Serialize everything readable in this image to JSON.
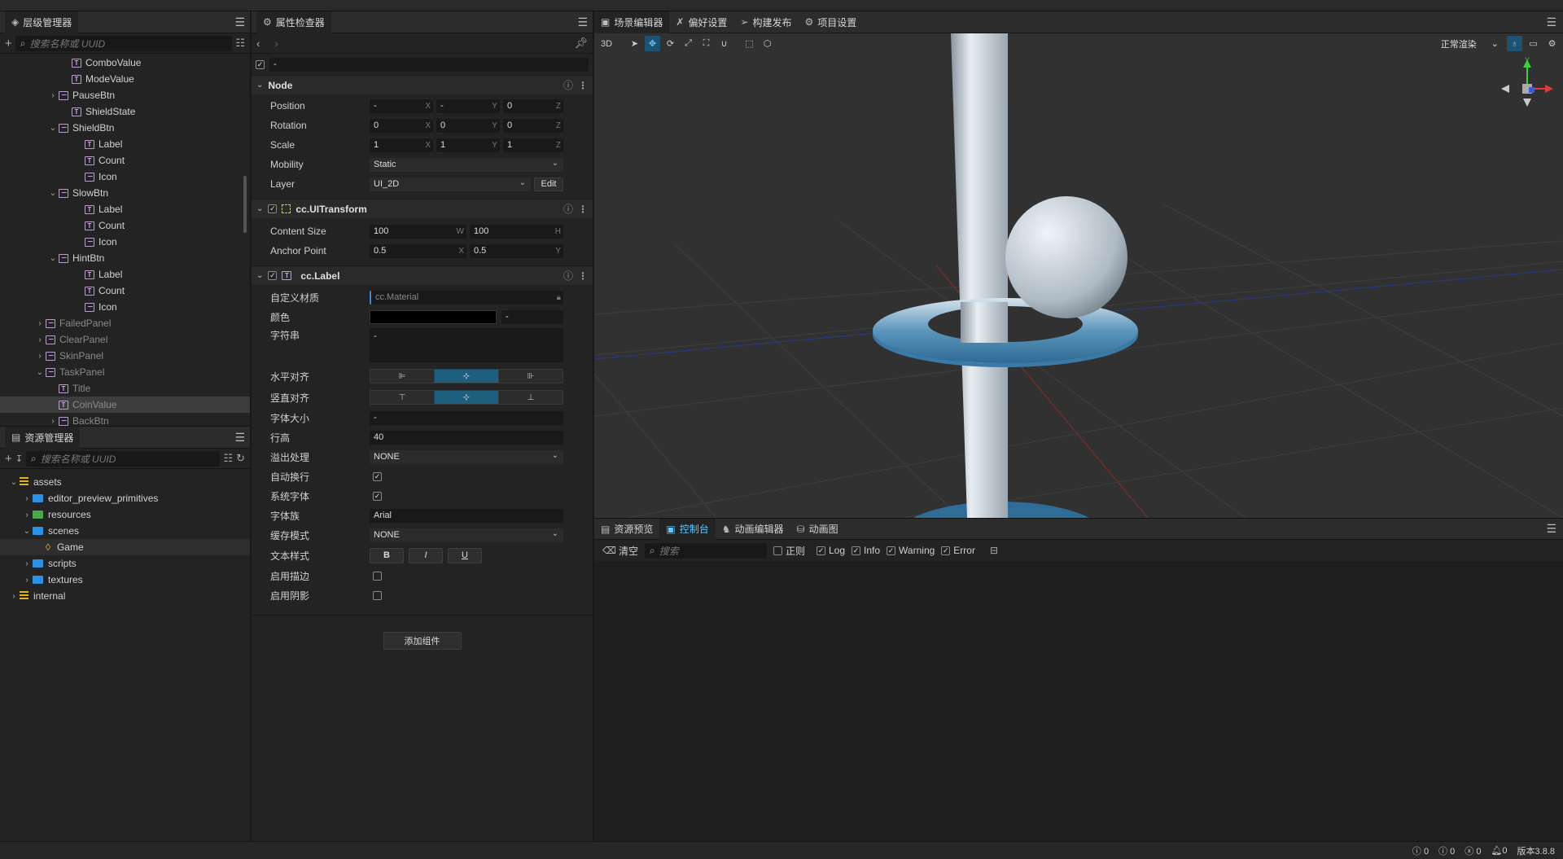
{
  "hierarchy": {
    "title": "层级管理器",
    "search_placeholder": "搜索名称或 UUID",
    "items": [
      {
        "label": "ComboValue",
        "icon": "text-icon",
        "indent": 5
      },
      {
        "label": "ModeValue",
        "icon": "text-icon",
        "indent": 5
      },
      {
        "label": "PauseBtn",
        "icon": "sprite-icon",
        "indent": 4,
        "arrow": "›"
      },
      {
        "label": "ShieldState",
        "icon": "text-icon",
        "indent": 5
      },
      {
        "label": "ShieldBtn",
        "icon": "sprite-icon",
        "indent": 4,
        "arrow": "⌄"
      },
      {
        "label": "Label",
        "icon": "text-icon",
        "indent": 6
      },
      {
        "label": "Count",
        "icon": "text-icon",
        "indent": 6
      },
      {
        "label": "Icon",
        "icon": "sprite-icon",
        "indent": 6
      },
      {
        "label": "SlowBtn",
        "icon": "sprite-icon",
        "indent": 4,
        "arrow": "⌄"
      },
      {
        "label": "Label",
        "icon": "text-icon",
        "indent": 6
      },
      {
        "label": "Count",
        "icon": "text-icon",
        "indent": 6
      },
      {
        "label": "Icon",
        "icon": "sprite-icon",
        "indent": 6
      },
      {
        "label": "HintBtn",
        "icon": "sprite-icon",
        "indent": 4,
        "arrow": "⌄"
      },
      {
        "label": "Label",
        "icon": "text-icon",
        "indent": 6
      },
      {
        "label": "Count",
        "icon": "text-icon",
        "indent": 6
      },
      {
        "label": "Icon",
        "icon": "sprite-icon",
        "indent": 6
      },
      {
        "label": "FailedPanel",
        "icon": "sprite-icon",
        "indent": 3,
        "arrow": "›",
        "dim": true
      },
      {
        "label": "ClearPanel",
        "icon": "sprite-icon",
        "indent": 3,
        "arrow": "›",
        "dim": true
      },
      {
        "label": "SkinPanel",
        "icon": "sprite-icon",
        "indent": 3,
        "arrow": "›",
        "dim": true
      },
      {
        "label": "TaskPanel",
        "icon": "sprite-icon",
        "indent": 3,
        "arrow": "⌄",
        "dim": true
      },
      {
        "label": "Title",
        "icon": "text-icon",
        "indent": 4,
        "dim": true
      },
      {
        "label": "CoinValue",
        "icon": "text-icon",
        "indent": 4,
        "dim": true,
        "selected": true
      },
      {
        "label": "BackBtn",
        "icon": "sprite-icon",
        "indent": 4,
        "arrow": "›",
        "dim": true
      }
    ]
  },
  "assets": {
    "title": "资源管理器",
    "search_placeholder": "搜索名称或 UUID",
    "items": [
      {
        "label": "assets",
        "type": "db",
        "indent": 1,
        "arrow": "⌄"
      },
      {
        "label": "editor_preview_primitives",
        "type": "folder",
        "indent": 2,
        "arrow": "›"
      },
      {
        "label": "resources",
        "type": "folder-green",
        "indent": 2,
        "arrow": "›"
      },
      {
        "label": "scenes",
        "type": "folder",
        "indent": 2,
        "arrow": "⌄"
      },
      {
        "label": "Game",
        "type": "scene",
        "indent": 3,
        "selected": true
      },
      {
        "label": "scripts",
        "type": "folder",
        "indent": 2,
        "arrow": "›"
      },
      {
        "label": "textures",
        "type": "folder",
        "indent": 2,
        "arrow": "›"
      },
      {
        "label": "internal",
        "type": "db",
        "indent": 1,
        "arrow": "›"
      }
    ]
  },
  "inspector": {
    "title": "属性检查器",
    "node_name": "-",
    "node_section": "Node",
    "position": {
      "label": "Position",
      "x": "-",
      "y": "-",
      "z": "0"
    },
    "rotation": {
      "label": "Rotation",
      "x": "0",
      "y": "0",
      "z": "0"
    },
    "scale": {
      "label": "Scale",
      "x": "1",
      "y": "1",
      "z": "1"
    },
    "mobility": {
      "label": "Mobility",
      "value": "Static"
    },
    "layer": {
      "label": "Layer",
      "value": "UI_2D",
      "edit": "Edit"
    },
    "uitransform": {
      "title": "cc.UITransform",
      "content_size": "Content Size",
      "w": "100",
      "h": "100",
      "anchor": "Anchor Point",
      "ax": "0.5",
      "ay": "0.5"
    },
    "label": {
      "title": "cc.Label",
      "material_label": "自定义材质",
      "material_value": "cc.Material",
      "color_label": "颜色",
      "color_value": "-",
      "string_label": "字符串",
      "string_value": "-",
      "halign_label": "水平对齐",
      "valign_label": "竖直对齐",
      "fontsize_label": "字体大小",
      "fontsize_value": "-",
      "lineheight_label": "行高",
      "lineheight_value": "40",
      "overflow_label": "溢出处理",
      "overflow_value": "NONE",
      "wrap_label": "自动换行",
      "sysfont_label": "系统字体",
      "family_label": "字体族",
      "family_value": "Arial",
      "cache_label": "缓存模式",
      "cache_value": "NONE",
      "style_label": "文本样式",
      "bold": "B",
      "italic": "I",
      "underline": "U",
      "outline_label": "启用描边",
      "shadow_label": "启用阴影"
    },
    "add_component": "添加组件"
  },
  "scene": {
    "tabs": [
      "场景编辑器",
      "偏好设置",
      "构建发布",
      "项目设置"
    ],
    "mode_3d": "3D",
    "render_mode": "正常渲染",
    "gizmo_y": "Y"
  },
  "console": {
    "tabs": [
      "资源预览",
      "控制台",
      "动画编辑器",
      "动画图"
    ],
    "clear": "清空",
    "search_placeholder": "搜索",
    "regex": "正则",
    "log": "Log",
    "info": "Info",
    "warning": "Warning",
    "error": "Error"
  },
  "status": {
    "c1": "0",
    "c2": "0",
    "c3": "0",
    "c4": "0",
    "version": "版本3.8.8"
  }
}
